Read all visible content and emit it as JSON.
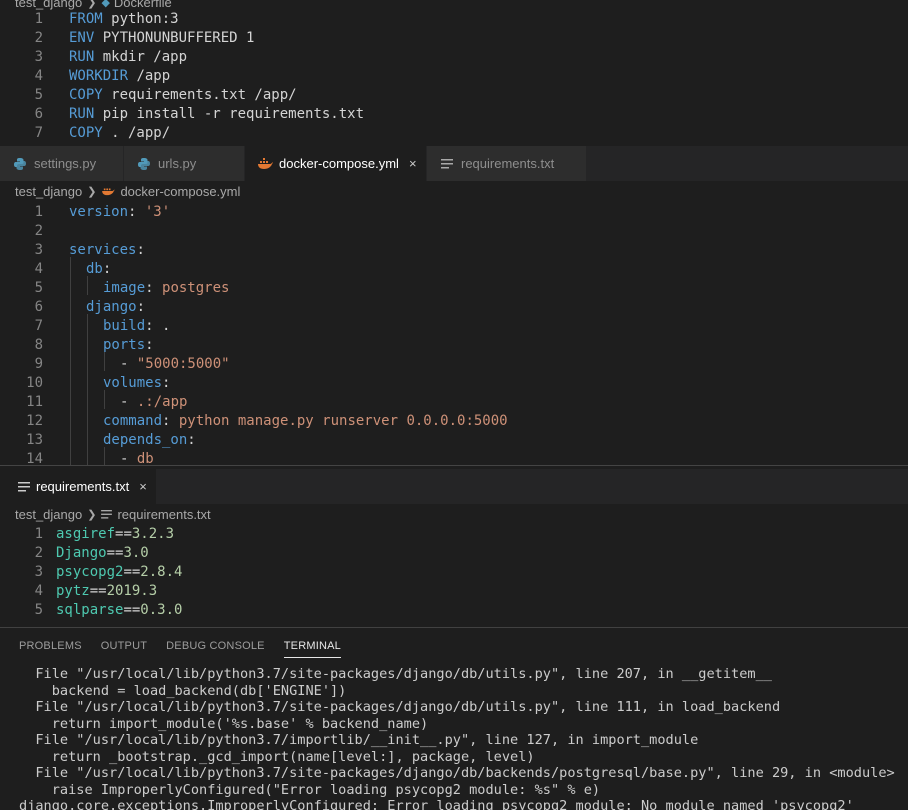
{
  "dockerfile_pane": {
    "breadcrumb": {
      "folder": "test_django",
      "file": "Dockerfile"
    },
    "lines": [
      {
        "n": "1",
        "kw": "FROM",
        "rest": " python:3"
      },
      {
        "n": "2",
        "kw": "ENV",
        "rest": " PYTHONUNBUFFERED 1"
      },
      {
        "n": "3",
        "kw": "RUN",
        "rest": " mkdir /app"
      },
      {
        "n": "4",
        "kw": "WORKDIR",
        "rest": " /app"
      },
      {
        "n": "5",
        "kw": "COPY",
        "rest": " requirements.txt /app/"
      },
      {
        "n": "6",
        "kw": "RUN",
        "rest": " pip install -r requirements.txt"
      },
      {
        "n": "7",
        "kw": "COPY",
        "rest": " . /app/"
      }
    ]
  },
  "compose_pane": {
    "tabs": [
      {
        "label": "settings.py",
        "icon": "python-icon",
        "active": false
      },
      {
        "label": "urls.py",
        "icon": "python-icon",
        "active": false
      },
      {
        "label": "docker-compose.yml",
        "icon": "docker-icon",
        "active": true,
        "close": "×"
      },
      {
        "label": "requirements.txt",
        "icon": "text-file-icon",
        "active": false
      }
    ],
    "breadcrumb": {
      "folder": "test_django",
      "file": "docker-compose.yml"
    },
    "lines": [
      {
        "n": "1",
        "key": "version",
        "sep": ": ",
        "val": "'3'"
      },
      {
        "n": "2"
      },
      {
        "n": "3",
        "key": "services",
        "sep": ":"
      },
      {
        "n": "4",
        "key": "db",
        "sep": ":"
      },
      {
        "n": "5",
        "key": "image",
        "sep": ": ",
        "val": "postgres"
      },
      {
        "n": "6",
        "key": "django",
        "sep": ":"
      },
      {
        "n": "7",
        "key": "build",
        "sep": ": ",
        "plain": "."
      },
      {
        "n": "8",
        "key": "ports",
        "sep": ":"
      },
      {
        "n": "9",
        "dash": "- ",
        "val": "\"5000:5000\""
      },
      {
        "n": "10",
        "key": "volumes",
        "sep": ":"
      },
      {
        "n": "11",
        "dash": "- ",
        "val": ".:/app"
      },
      {
        "n": "12",
        "key": "command",
        "sep": ": ",
        "val": "python manage.py runserver 0.0.0.0:5000"
      },
      {
        "n": "13",
        "key": "depends_on",
        "sep": ":"
      },
      {
        "n": "14",
        "dash": "- ",
        "val": "db"
      }
    ]
  },
  "requirements_pane": {
    "tab": {
      "label": "requirements.txt",
      "close": "×"
    },
    "breadcrumb": {
      "folder": "test_django",
      "file": "requirements.txt"
    },
    "lines": [
      {
        "n": "1",
        "pkg": "asgiref",
        "op": "==",
        "ver": "3.2.3"
      },
      {
        "n": "2",
        "pkg": "Django",
        "op": "==",
        "ver": "3.0"
      },
      {
        "n": "3",
        "pkg": "psycopg2",
        "op": "==",
        "ver": "2.8.4"
      },
      {
        "n": "4",
        "pkg": "pytz",
        "op": "==",
        "ver": "2019.3"
      },
      {
        "n": "5",
        "pkg": "sqlparse",
        "op": "==",
        "ver": "0.3.0"
      }
    ]
  },
  "panel": {
    "tabs": [
      "PROBLEMS",
      "OUTPUT",
      "DEBUG CONSOLE",
      "TERMINAL"
    ],
    "active_tab": "TERMINAL",
    "terminal_lines": [
      "  File \"/usr/local/lib/python3.7/site-packages/django/db/utils.py\", line 207, in __getitem__",
      "    backend = load_backend(db['ENGINE'])",
      "  File \"/usr/local/lib/python3.7/site-packages/django/db/utils.py\", line 111, in load_backend",
      "    return import_module('%s.base' % backend_name)",
      "  File \"/usr/local/lib/python3.7/importlib/__init__.py\", line 127, in import_module",
      "    return _bootstrap._gcd_import(name[level:], package, level)",
      "  File \"/usr/local/lib/python3.7/site-packages/django/db/backends/postgresql/base.py\", line 29, in <module>",
      "    raise ImproperlyConfigured(\"Error loading psycopg2 module: %s\" % e)",
      "django.core.exceptions.ImproperlyConfigured: Error loading psycopg2 module: No module named 'psycopg2'"
    ]
  },
  "colors": {
    "editor_bg": "#1e1e1e",
    "keyword": "#569cd6",
    "string": "#ce9178",
    "package": "#4ec9b0",
    "number": "#b5cea8",
    "python_icon": "#519aba",
    "docker_icon": "#e37933"
  }
}
